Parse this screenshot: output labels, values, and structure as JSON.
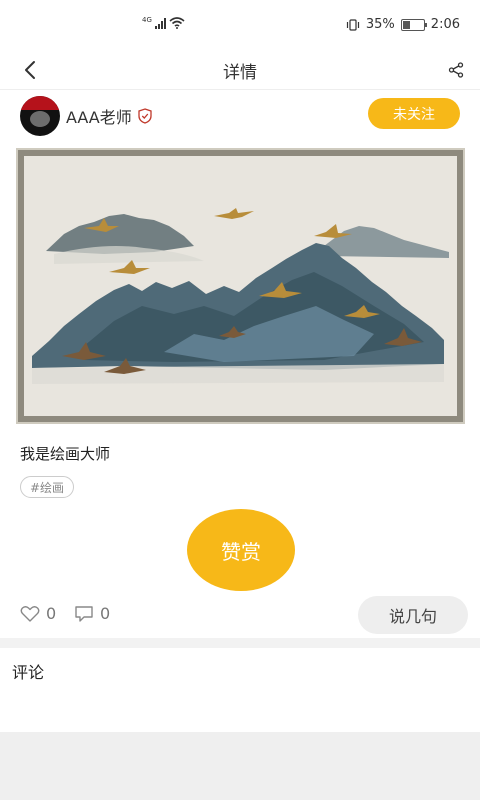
{
  "status_bar": {
    "network": "4G",
    "battery_percent": "35%",
    "time": "2:06",
    "icons": [
      "signal-icon",
      "wifi-icon",
      "vibrate-icon",
      "battery-icon"
    ]
  },
  "navbar": {
    "title": "详情",
    "back_icon": "chevron-left-icon",
    "share_icon": "share-icon"
  },
  "author": {
    "name": "AAA老师",
    "verified_icon": "verified-shield-icon",
    "follow_label": "未关注"
  },
  "post": {
    "title": "我是绘画大师",
    "tags": [
      "#绘画"
    ]
  },
  "actions": {
    "reward_label": "赞赏",
    "likes_count": "0",
    "comments_count": "0",
    "comment_button_label": "说几句"
  },
  "comments": {
    "section_label": "评论"
  },
  "colors": {
    "accent": "#f7b818",
    "background": "#ffffff",
    "muted": "#efefef"
  }
}
